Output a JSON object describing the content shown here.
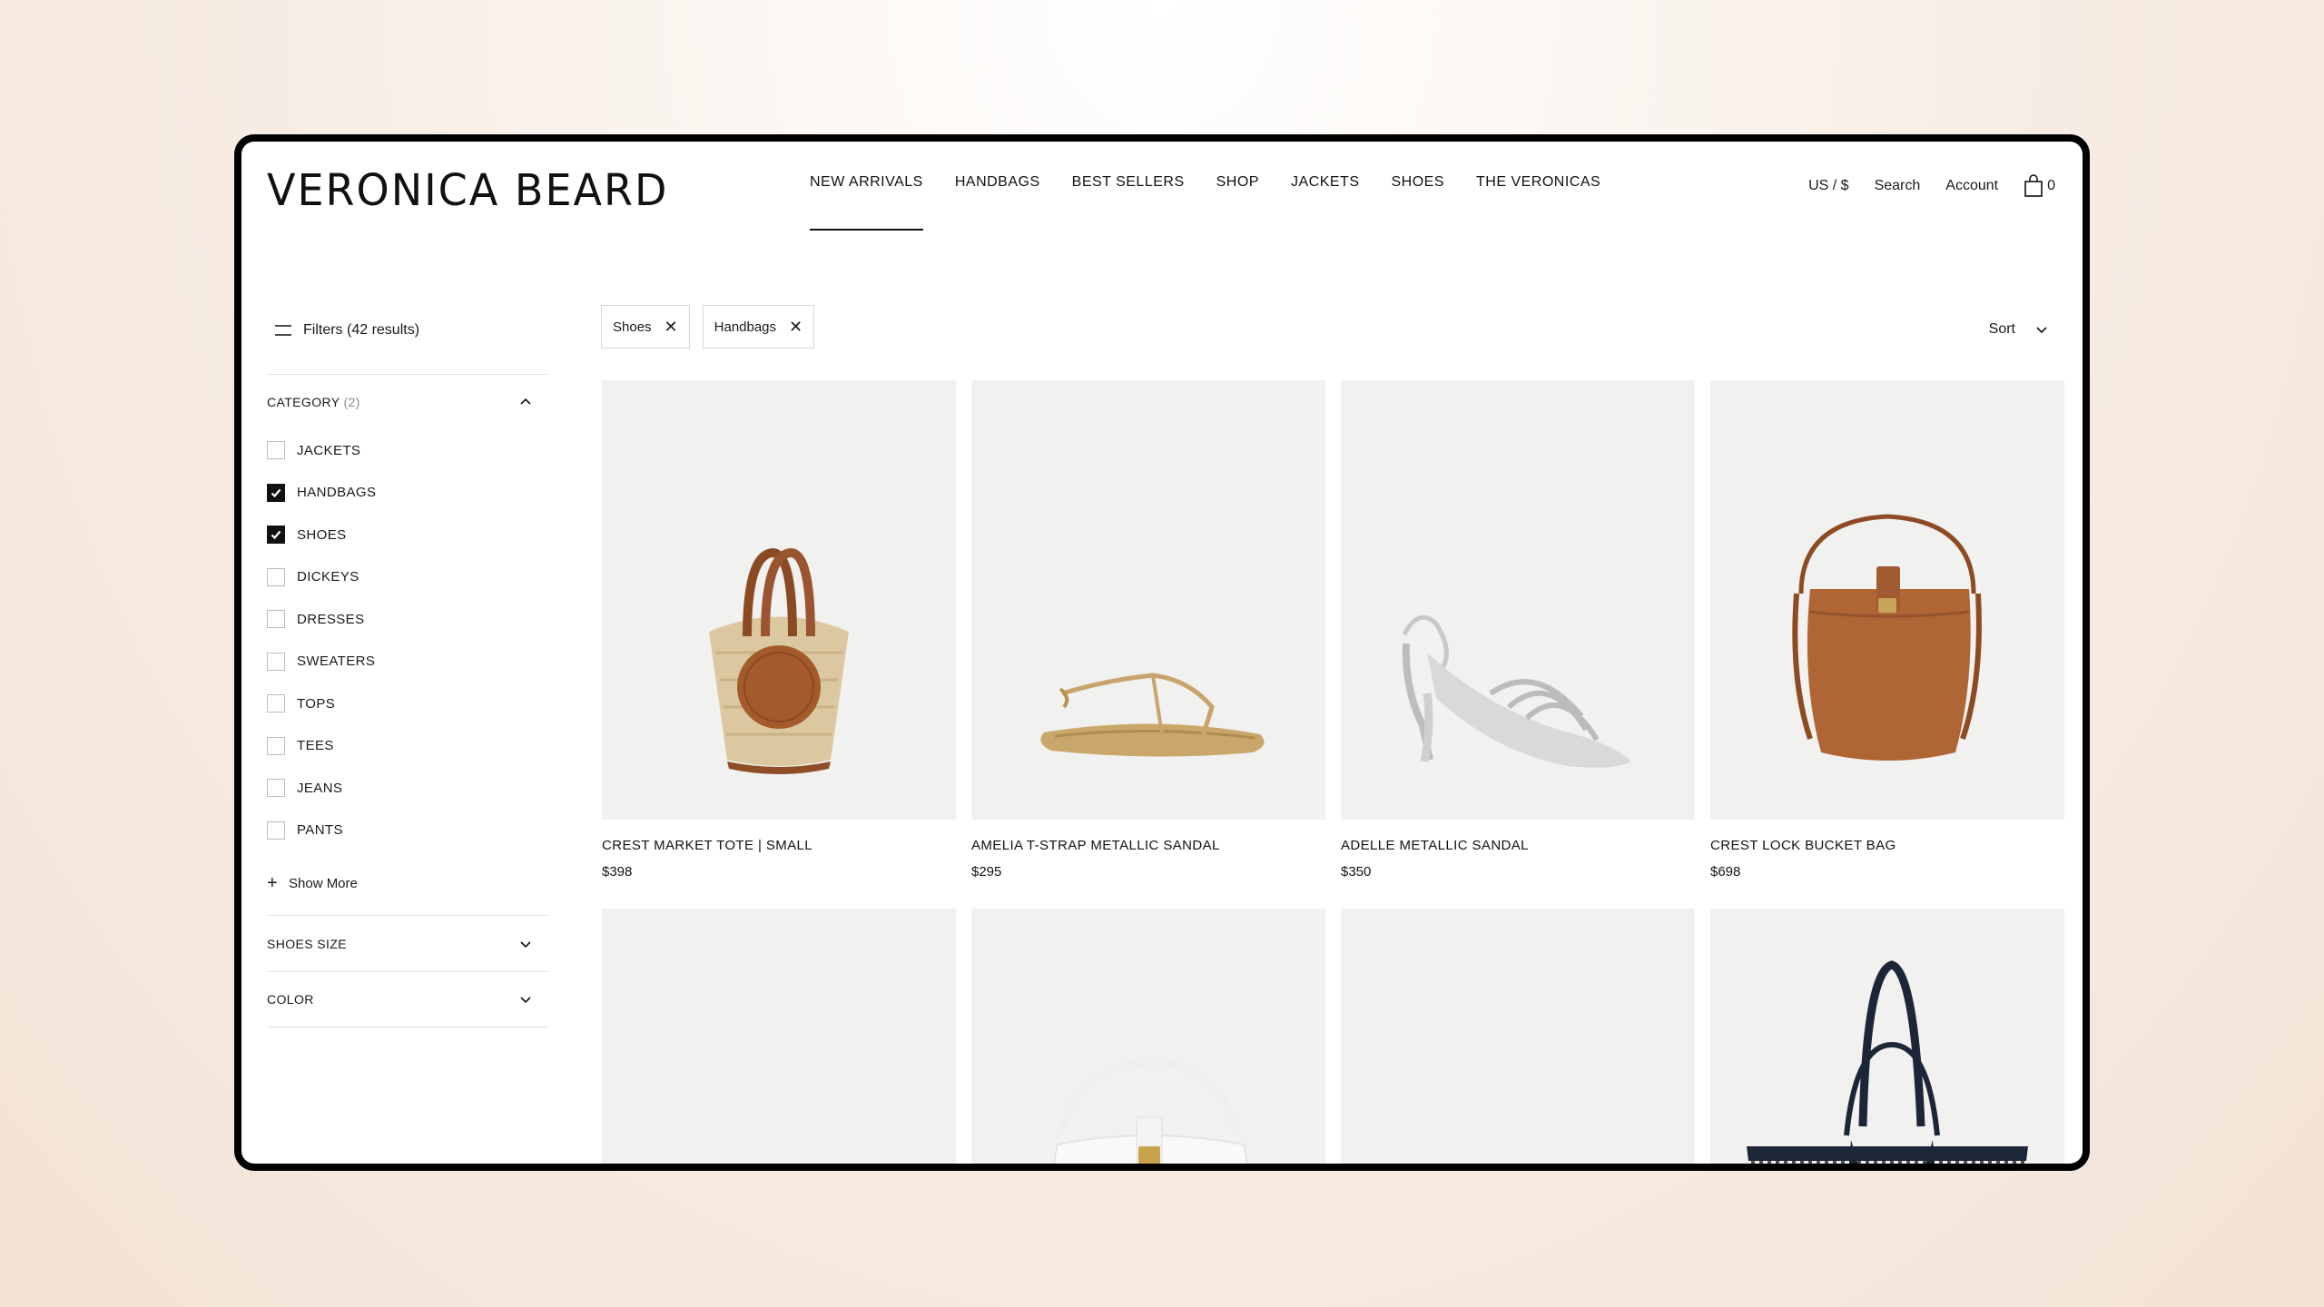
{
  "brand": {
    "logo": "VERONICA BEARD"
  },
  "nav": {
    "items": [
      "NEW ARRIVALS",
      "HANDBAGS",
      "BEST SELLERS",
      "SHOP",
      "JACKETS",
      "SHOES",
      "THE VERONICAS"
    ],
    "active_index": 0
  },
  "utility": {
    "locale": "US / $",
    "search": "Search",
    "account": "Account",
    "cart_count": "0"
  },
  "filters": {
    "label": "Filters (42 results)",
    "category": {
      "title": "CATEGORY",
      "count": "(2)",
      "items": [
        {
          "label": "JACKETS",
          "checked": false
        },
        {
          "label": "HANDBAGS",
          "checked": true
        },
        {
          "label": "SHOES",
          "checked": true
        },
        {
          "label": "DICKEYS",
          "checked": false
        },
        {
          "label": "DRESSES",
          "checked": false
        },
        {
          "label": "SWEATERS",
          "checked": false
        },
        {
          "label": "TOPS",
          "checked": false
        },
        {
          "label": "TEES",
          "checked": false
        },
        {
          "label": "JEANS",
          "checked": false
        },
        {
          "label": "PANTS",
          "checked": false
        }
      ],
      "show_more": "Show More"
    },
    "sections": [
      "SHOES SIZE",
      "COLOR"
    ]
  },
  "active_filters": [
    {
      "label": "Shoes",
      "remove": "✕"
    },
    {
      "label": "Handbags",
      "remove": "✕"
    }
  ],
  "sort": {
    "label": "Sort"
  },
  "products": [
    {
      "name": "CREST MARKET TOTE | SMALL",
      "price": "$398",
      "image": "straw-tote"
    },
    {
      "name": "AMELIA T-STRAP METALLIC SANDAL",
      "price": "$295",
      "image": "gold-flat-sandal"
    },
    {
      "name": "ADELLE METALLIC SANDAL",
      "price": "$350",
      "image": "silver-heel-sandal"
    },
    {
      "name": "CREST LOCK BUCKET BAG",
      "price": "$698",
      "image": "brown-bucket-bag"
    },
    {
      "name": "",
      "price": "",
      "image": "empty"
    },
    {
      "name": "",
      "price": "",
      "image": "white-bag"
    },
    {
      "name": "",
      "price": "",
      "image": "tan-heel"
    },
    {
      "name": "",
      "price": "",
      "image": "striped-tote"
    }
  ],
  "colors": {
    "accent": "#111111",
    "tile_bg": "#f1f1f0",
    "border": "#e2e2e2"
  }
}
